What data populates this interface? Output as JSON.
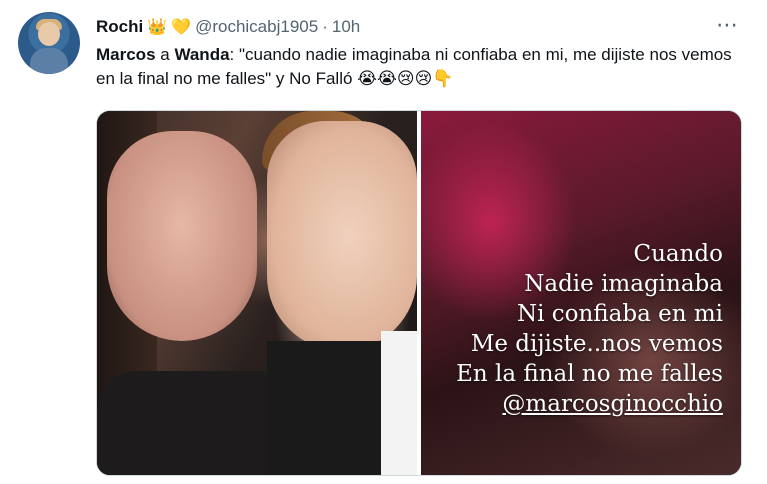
{
  "tweet": {
    "author_name": "Rochi",
    "author_emojis": [
      "👑",
      "💛"
    ],
    "handle": "@rochicabj1905",
    "separator": "·",
    "time": "10h",
    "menu_icon": "more-horizontal-icon",
    "text_part1": "Marcos",
    "text_part2": " a ",
    "text_part3": "Wanda",
    "text_part4": ": \"cuando nadie imaginaba ni confiaba en mi, me dijiste nos vemos en la final no me falles\" y No Falló ",
    "text_emojis": "😭😭😢😢👇"
  },
  "media": {
    "story_lines": [
      "Cuando",
      "Nadie imaginaba",
      "Ni confiaba en mi",
      "Me dijiste..nos vemos",
      "En la final no me falles",
      "@marcosginocchio"
    ]
  }
}
